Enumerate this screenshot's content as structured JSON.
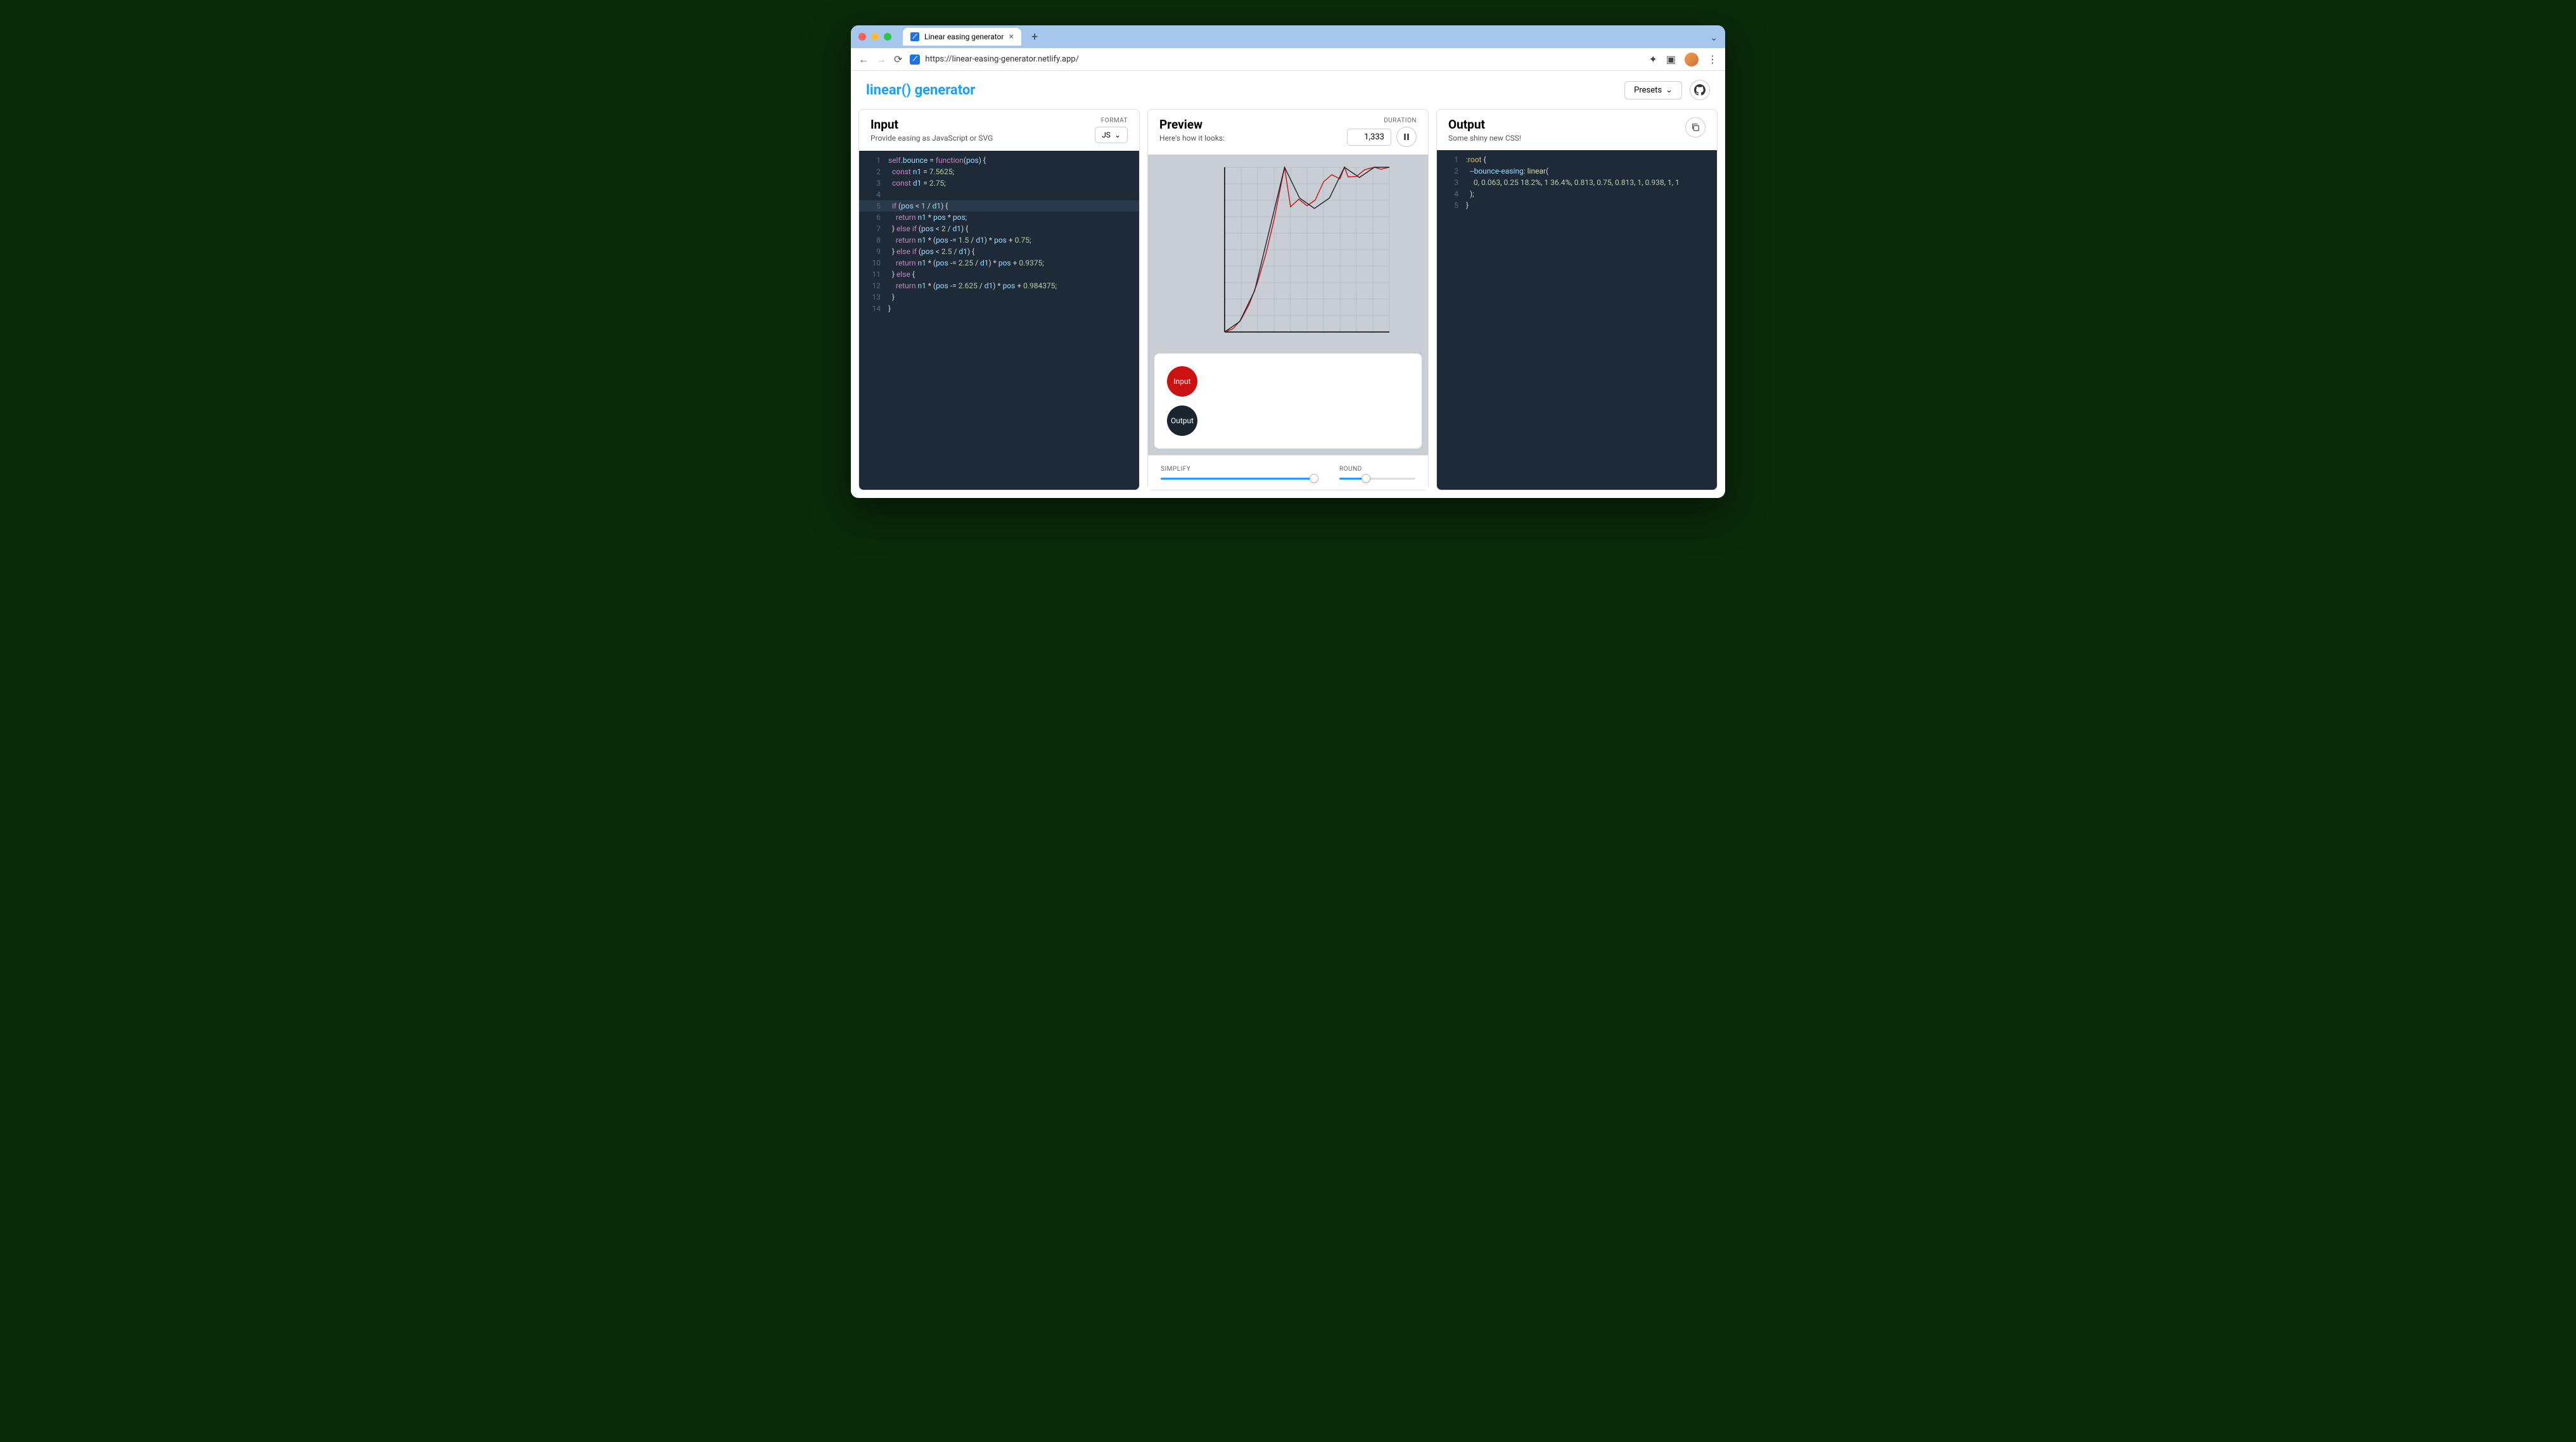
{
  "browser": {
    "tab_title": "Linear easing generator",
    "url": "https://linear-easing-generator.netlify.app/"
  },
  "header": {
    "logo": "linear() generator",
    "presets_label": "Presets"
  },
  "input_panel": {
    "title": "Input",
    "subtitle": "Provide easing as JavaScript or SVG",
    "format_label": "FORMAT",
    "format_value": "JS",
    "code_lines": [
      "self.bounce = function(pos) {",
      "  const n1 = 7.5625;",
      "  const d1 = 2.75;",
      "",
      "  if (pos < 1 / d1) {",
      "    return n1 * pos * pos;",
      "  } else if (pos < 2 / d1) {",
      "    return n1 * (pos -= 1.5 / d1) * pos + 0.75;",
      "  } else if (pos < 2.5 / d1) {",
      "    return n1 * (pos -= 2.25 / d1) * pos + 0.9375;",
      "  } else {",
      "    return n1 * (pos -= 2.625 / d1) * pos + 0.984375;",
      "  }",
      "}"
    ]
  },
  "preview_panel": {
    "title": "Preview",
    "subtitle": "Here's how it looks:",
    "duration_label": "DURATION",
    "duration_value": "1,333",
    "ball_input_label": "Input",
    "ball_output_label": "Output"
  },
  "output_panel": {
    "title": "Output",
    "subtitle": "Some shiny new CSS!",
    "code_lines": [
      ":root {",
      "  --bounce-easing: linear(",
      "    0, 0.063, 0.25 18.2%, 1 36.4%, 0.813, 0.75, 0.813, 1, 0.938, 1, 1",
      "  );",
      "}"
    ]
  },
  "sliders": {
    "simplify_label": "SIMPLIFY",
    "simplify_percent": 100,
    "round_label": "ROUND",
    "round_percent": 35
  },
  "chart_data": {
    "type": "line",
    "title": "",
    "xlabel": "",
    "ylabel": "",
    "xlim": [
      0,
      1
    ],
    "ylim": [
      0,
      1
    ],
    "series": [
      {
        "name": "Input",
        "color": "#cc1111",
        "x": [
          0,
          0.05,
          0.1,
          0.15,
          0.2,
          0.25,
          0.3,
          0.3636,
          0.4,
          0.45,
          0.5,
          0.55,
          0.6,
          0.65,
          0.7,
          0.7273,
          0.75,
          0.8,
          0.85,
          0.9091,
          0.95,
          1.0
        ],
        "values": [
          0,
          0.019,
          0.076,
          0.17,
          0.303,
          0.473,
          0.681,
          1.0,
          0.76,
          0.806,
          0.766,
          0.801,
          0.911,
          0.955,
          0.93,
          1.0,
          0.941,
          0.944,
          0.985,
          1.0,
          0.988,
          1.0
        ]
      },
      {
        "name": "Output",
        "color": "#1a2530",
        "x": [
          0,
          0.091,
          0.182,
          0.364,
          0.455,
          0.545,
          0.636,
          0.727,
          0.818,
          0.909,
          1.0
        ],
        "values": [
          0,
          0.063,
          0.25,
          1.0,
          0.813,
          0.75,
          0.813,
          1.0,
          0.938,
          1.0,
          1.0
        ]
      }
    ]
  }
}
